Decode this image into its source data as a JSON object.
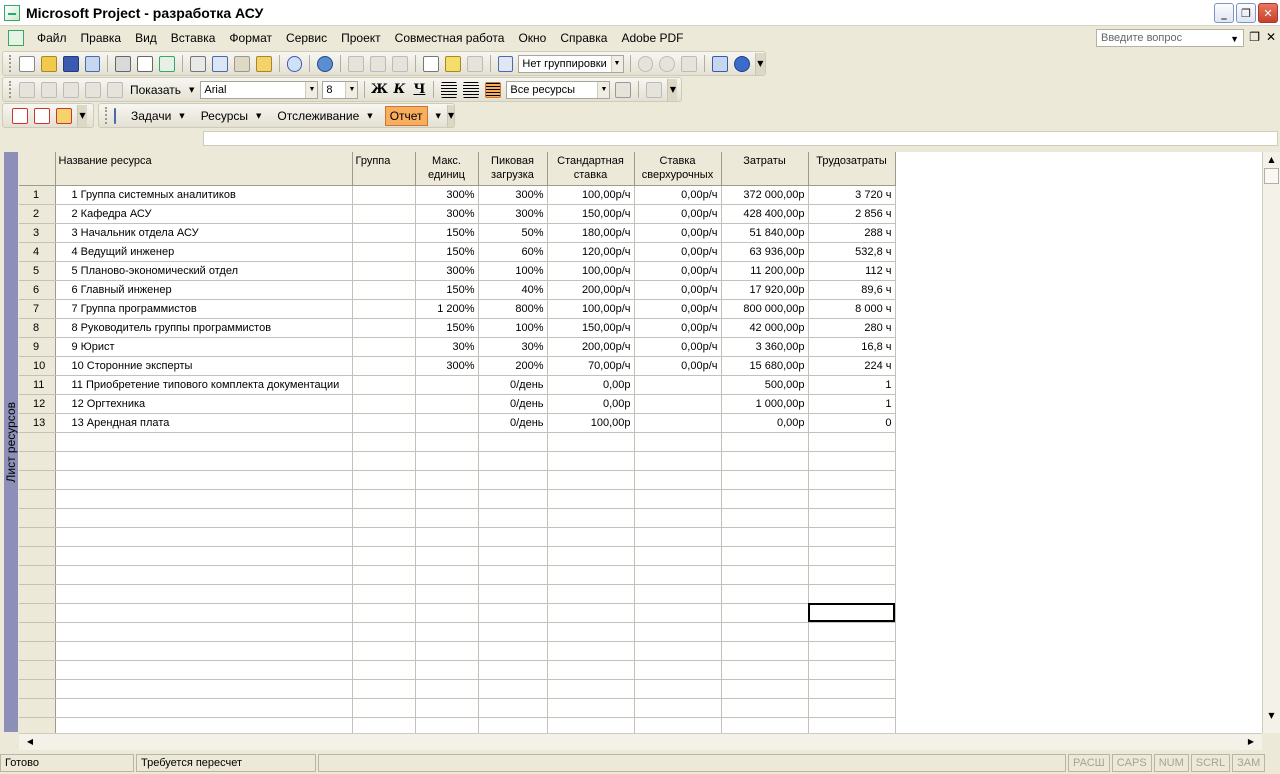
{
  "window": {
    "title": "Microsoft Project - разработка АСУ"
  },
  "menu": {
    "items": [
      "Файл",
      "Правка",
      "Вид",
      "Вставка",
      "Формат",
      "Сервис",
      "Проект",
      "Совместная работа",
      "Окно",
      "Справка",
      "Adobe PDF"
    ],
    "help_placeholder": "Введите вопрос"
  },
  "toolbar1": {
    "grouping": "Нет группировки"
  },
  "toolbar2": {
    "show_label": "Показать",
    "font": "Arial",
    "size": "8",
    "bold": "Ж",
    "italic": "К",
    "underline": "Ч",
    "filter": "Все ресурсы"
  },
  "toolbar3": {
    "tasks": "Задачи",
    "resources": "Ресурсы",
    "tracking": "Отслеживание",
    "report": "Отчет"
  },
  "view_bar": {
    "label": "Лист ресурсов"
  },
  "table": {
    "headers": [
      "Название ресурса",
      "Группа",
      "Макс. единиц",
      "Пиковая загрузка",
      "Стандартная ставка",
      "Ставка сверхурочных",
      "Затраты",
      "Трудозатраты"
    ],
    "rows": [
      {
        "id": "1",
        "name": "1 Группа системных аналитиков",
        "group": "",
        "max": "300%",
        "peak": "300%",
        "std": "100,00р/ч",
        "ovt": "0,00р/ч",
        "cost": "372 000,00р",
        "work": "3 720 ч"
      },
      {
        "id": "2",
        "name": "2 Кафедра АСУ",
        "group": "",
        "max": "300%",
        "peak": "300%",
        "std": "150,00р/ч",
        "ovt": "0,00р/ч",
        "cost": "428 400,00р",
        "work": "2 856 ч"
      },
      {
        "id": "3",
        "name": "3 Начальник отдела АСУ",
        "group": "",
        "max": "150%",
        "peak": "50%",
        "std": "180,00р/ч",
        "ovt": "0,00р/ч",
        "cost": "51 840,00р",
        "work": "288 ч"
      },
      {
        "id": "4",
        "name": "4 Ведущий инженер",
        "group": "",
        "max": "150%",
        "peak": "60%",
        "std": "120,00р/ч",
        "ovt": "0,00р/ч",
        "cost": "63 936,00р",
        "work": "532,8 ч"
      },
      {
        "id": "5",
        "name": "5 Планово-экономический отдел",
        "group": "",
        "max": "300%",
        "peak": "100%",
        "std": "100,00р/ч",
        "ovt": "0,00р/ч",
        "cost": "11 200,00р",
        "work": "112 ч"
      },
      {
        "id": "6",
        "name": "6 Главный инженер",
        "group": "",
        "max": "150%",
        "peak": "40%",
        "std": "200,00р/ч",
        "ovt": "0,00р/ч",
        "cost": "17 920,00р",
        "work": "89,6 ч"
      },
      {
        "id": "7",
        "name": "7 Группа программистов",
        "group": "",
        "max": "1 200%",
        "peak": "800%",
        "std": "100,00р/ч",
        "ovt": "0,00р/ч",
        "cost": "800 000,00р",
        "work": "8 000 ч"
      },
      {
        "id": "8",
        "name": "8 Руководитель группы программистов",
        "group": "",
        "max": "150%",
        "peak": "100%",
        "std": "150,00р/ч",
        "ovt": "0,00р/ч",
        "cost": "42 000,00р",
        "work": "280 ч"
      },
      {
        "id": "9",
        "name": "9 Юрист",
        "group": "",
        "max": "30%",
        "peak": "30%",
        "std": "200,00р/ч",
        "ovt": "0,00р/ч",
        "cost": "3 360,00р",
        "work": "16,8 ч"
      },
      {
        "id": "10",
        "name": "10 Сторонние эксперты",
        "group": "",
        "max": "300%",
        "peak": "200%",
        "std": "70,00р/ч",
        "ovt": "0,00р/ч",
        "cost": "15 680,00р",
        "work": "224 ч"
      },
      {
        "id": "11",
        "name": "11 Приобретение типового комплекта документации",
        "group": "",
        "max": "",
        "peak": "0/день",
        "std": "0,00р",
        "ovt": "",
        "cost": "500,00р",
        "work": "1"
      },
      {
        "id": "12",
        "name": "12 Оргтехника",
        "group": "",
        "max": "",
        "peak": "0/день",
        "std": "0,00р",
        "ovt": "",
        "cost": "1 000,00р",
        "work": "1"
      },
      {
        "id": "13",
        "name": "13 Арендная плата",
        "group": "",
        "max": "",
        "peak": "0/день",
        "std": "100,00р",
        "ovt": "",
        "cost": "0,00р",
        "work": "0"
      }
    ]
  },
  "status": {
    "ready": "Готово",
    "recalc": "Требуется пересчет",
    "indicators": [
      "РАСШ",
      "CAPS",
      "NUM",
      "SCRL",
      "ЗАМ"
    ]
  }
}
